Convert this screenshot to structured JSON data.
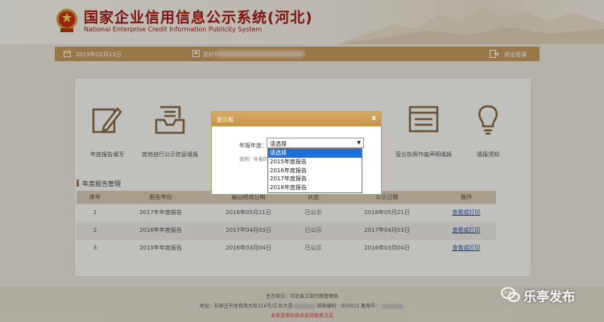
{
  "header": {
    "title_cn": "国家企业信用信息公示系统(河北)",
    "title_en": "National Enterprise Credit Information Publicity System"
  },
  "topbar": {
    "date": "2019年02月13日",
    "greeting": "您好！",
    "logout": "退出登录"
  },
  "tiles": [
    {
      "label": "年度报告填写",
      "icon": "pen-icon"
    },
    {
      "label": "其他自行公示信息填报",
      "icon": "inbox-icon"
    },
    {
      "label": "营业执照作废声明填报",
      "icon": "browser-icon"
    },
    {
      "label": "填报须知",
      "icon": "lightbulb-icon"
    }
  ],
  "section": {
    "title": "年度报告管理"
  },
  "table": {
    "headers": [
      "序号",
      "报告年份",
      "最后修改日期",
      "状态",
      "公示日期",
      "操作"
    ],
    "rows": [
      [
        "1",
        "2017年年度报告",
        "2018年05月21日",
        "已公示",
        "2018年05月21日",
        "查看或打印"
      ],
      [
        "2",
        "2016年年度报告",
        "2017年04月03日",
        "已公示",
        "2017年04月03日",
        "查看或打印"
      ],
      [
        "3",
        "2015年年度报告",
        "2016年03月04日",
        "已公示",
        "2016年03月04日",
        "查看或打印"
      ]
    ]
  },
  "modal": {
    "title": "提示框",
    "close": "x",
    "year_label": "年报年度：",
    "select_value": "请选择",
    "note": "说明：补报的",
    "options": [
      "请选择",
      "2015年度报告",
      "2016年度报告",
      "2017年度报告",
      "2018年度报告"
    ]
  },
  "footer": {
    "line1": "主办单位：河北省工商行政管理局",
    "line2a": "地址：石家庄市体育南大街316号/汇显大道",
    "line2b": "邮政编码：050021 备案号：",
    "line3": "业务咨询与技术支持联系方式"
  },
  "watermark": {
    "text": "乐亭发布"
  },
  "colors": {
    "brand_red": "#a41c14",
    "bar_gold": "#c59a5b",
    "link": "#2b58b8",
    "highlight": "#1e6fd9"
  }
}
